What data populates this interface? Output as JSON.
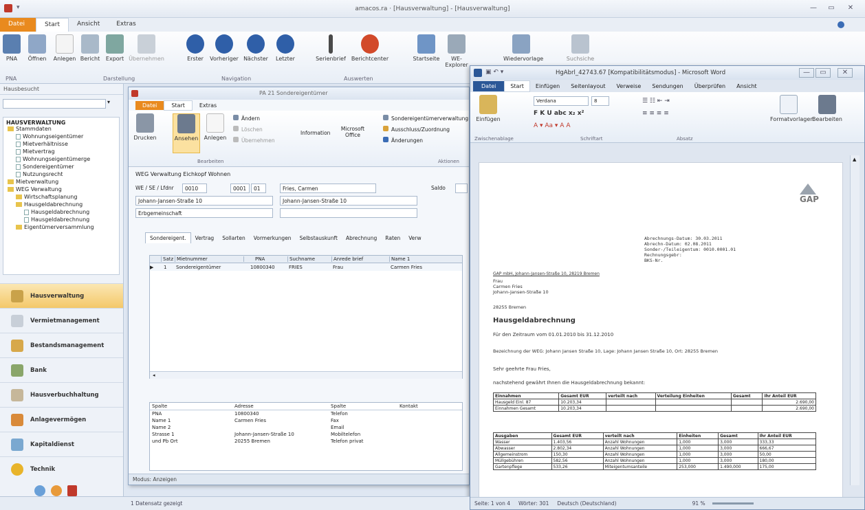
{
  "app": {
    "title": "amacos.ra · [Hausverwaltung] - [Hausverwaltung]",
    "tabs": [
      "Datei",
      "Start",
      "Ansicht",
      "Extras"
    ]
  },
  "ribbon": {
    "buttons": [
      "PNA",
      "Öffnen",
      "Anlegen",
      "Bericht",
      "Export",
      "Übernehmen",
      "Erster",
      "Vorheriger",
      "Nächster",
      "Letzter",
      "Serienbrief",
      "Berichtcenter",
      "Startseite",
      "WE-Explorer",
      "Wiedervorlage",
      "Suchsiche"
    ],
    "groups": [
      "PNA",
      "Darstellung",
      "Navigation",
      "Auswerten"
    ]
  },
  "nav": {
    "header": "Hausbesucht",
    "section": "HAUSVERWALTUNG",
    "tree": [
      "Stammdaten",
      "Wohnungseigentümer",
      "Mietverhältnisse",
      "Mietvertrag",
      "Wohnungseigentümerge",
      "Sondereigentümer",
      "Nutzungsrecht",
      "Mietverwaltung",
      "WEG Verwaltung",
      "Wirtschaftsplanung",
      "Hausgeldabrechnung",
      "Hausgeldabrechnung",
      "Hausgeldabrechnung",
      "Eigentümerversammlung"
    ],
    "modules": [
      "Hausverwaltung",
      "Vermietmanagement",
      "Bestandsmanagement",
      "Bank",
      "Hausverbuchhaltung",
      "Anlagevermögen",
      "Kapitaldienst",
      "Technik"
    ]
  },
  "inner": {
    "title": "PA 21 Sondereigentümer",
    "tabs": [
      "Datei",
      "Start",
      "Extras"
    ],
    "buttons": [
      "Drucken",
      "Ansehen",
      "Anlegen",
      "Ändern",
      "Löschen",
      "Übernehmen",
      "Information",
      "Microsoft Office",
      "Sondereigentümerverwaltung",
      "Ausschluss/Zuordnung",
      "Änderungen"
    ],
    "groups": [
      "Bearbeiten",
      "Aktionen"
    ],
    "section": "WEG Verwaltung Eichkopf Wohnen",
    "labels": {
      "we": "WE / SE / Lfdnr",
      "saldo": "Saldo"
    },
    "fields": {
      "we": "0010",
      "se": "0001",
      "lfd": "01",
      "name": "Fries, Carmen",
      "addr1": "Johann-Jansen-Straße 10",
      "addr2": "Johann-Jansen-Straße 10",
      "type": "Erbgemeinschaft"
    },
    "subtabs": [
      "Sondereigent.",
      "Vertrag",
      "Sollarten",
      "Vormerkungen",
      "Selbstauskunft",
      "Abrechnung",
      "Raten",
      "Verw"
    ],
    "grid": {
      "headers": [
        "Satz",
        "Mietnummer",
        "PNA",
        "Suchname",
        "Anrede brief",
        "Name 1"
      ],
      "row": [
        "1",
        "Sondereigentümer",
        "10800340",
        "FRIES",
        "Frau",
        "Carmen Fries"
      ]
    },
    "detail": {
      "headers": [
        "Spalte",
        "Adresse",
        "Spalte",
        "Kontakt"
      ],
      "rows": [
        [
          "PNA",
          "10800340",
          "Telefon",
          ""
        ],
        [
          "Name 1",
          "Carmen Fries",
          "Fax",
          ""
        ],
        [
          "Name 2",
          "",
          "Email",
          ""
        ],
        [
          "Strasse 1",
          "Johann-Jansen-Straße 10",
          "Mobiltelefon",
          ""
        ],
        [
          "und Pb Ort",
          "20255 Bremen",
          "Telefon privat",
          ""
        ]
      ]
    },
    "status": "Modus: Anzeigen"
  },
  "word": {
    "title": "HgAbrl_42743.67 [Kompatibilitätsmodus] - Microsoft Word",
    "tabs": [
      "Datei",
      "Start",
      "Einfügen",
      "Seitenlayout",
      "Verweise",
      "Sendungen",
      "Überprüfen",
      "Ansicht"
    ],
    "font": "Verdana",
    "size": "8",
    "groups": [
      "Zwischenablage",
      "Schriftart",
      "Absatz"
    ],
    "btns": [
      "Einfügen",
      "Formatvorlagen",
      "Bearbeiten"
    ],
    "letter": {
      "meta": [
        "Abrechnungs-Datum:   30.03.2011",
        "Abrechn-Datum:   02.08.2011",
        "Sonder-/Teileigentum:   0010.0001.01",
        "Rechnungsgebr:",
        "BKS-Nr."
      ],
      "sender": "GAP mbH, Johann-Jansen-Straße 10, 28219 Bremen",
      "recipient": [
        "Frau",
        "Carmen Fries",
        "Johann-Jansen-Straße 10",
        "28255 Bremen"
      ],
      "heading": "Hausgeldabrechnung",
      "period": "Für den Zeitraum vom 01.01.2010 bis 31.12.2010",
      "object": "Bezeichnung der WEG: Johann Jansen Straße 10, Lage: Johann Jansen Straße 10, Ort: 28255 Bremen",
      "salut": "Sehr geehrte Frau Fries,",
      "intro": "nachstehend gewährt Ihnen die Hausgeldabrechnung bekannt:",
      "t1head": [
        "Einnahmen",
        "Gesamt EUR",
        "verteilt nach",
        "Verteilung Einheiten",
        "Gesamt",
        "Ihr Anteil EUR"
      ],
      "t1rows": [
        [
          "Hausgeld Einl. 87",
          "10.203,34",
          "",
          "",
          "",
          "2.690,00"
        ],
        [
          "Einnahmen Gesamt",
          "10.203,34",
          "",
          "",
          "",
          "2.690,00"
        ]
      ],
      "t2head": [
        "Ausgaben",
        "Gesamt EUR",
        "verteilt nach",
        "Einheiten",
        "Gesamt",
        "Ihr Anteil EUR"
      ],
      "t2rows": [
        [
          "Wasser",
          "1.403,56",
          "Anzahl Wohnungen",
          "1,000",
          "3,000",
          "333,33"
        ],
        [
          "Abwasser",
          "2.802,34",
          "Anzahl Wohnungen",
          "1,000",
          "3,000",
          "666,67"
        ],
        [
          "Allgemeinstrom",
          "150,30",
          "Anzahl Wohnungen",
          "1,000",
          "3,000",
          "50,00"
        ],
        [
          "Müllgebühren",
          "582,56",
          "Anzahl Wohnungen",
          "1,000",
          "3,000",
          "180,00"
        ],
        [
          "Gartenpflege",
          "533,26",
          "Miteigentumsanteile",
          "253,000",
          "1.490,000",
          "175,00"
        ]
      ]
    },
    "status": {
      "page": "Seite: 1 von 4",
      "words": "Wörter: 301",
      "lang": "Deutsch (Deutschland)",
      "zoom": "91 %"
    }
  },
  "footer": "1 Datensatz gezeigt"
}
